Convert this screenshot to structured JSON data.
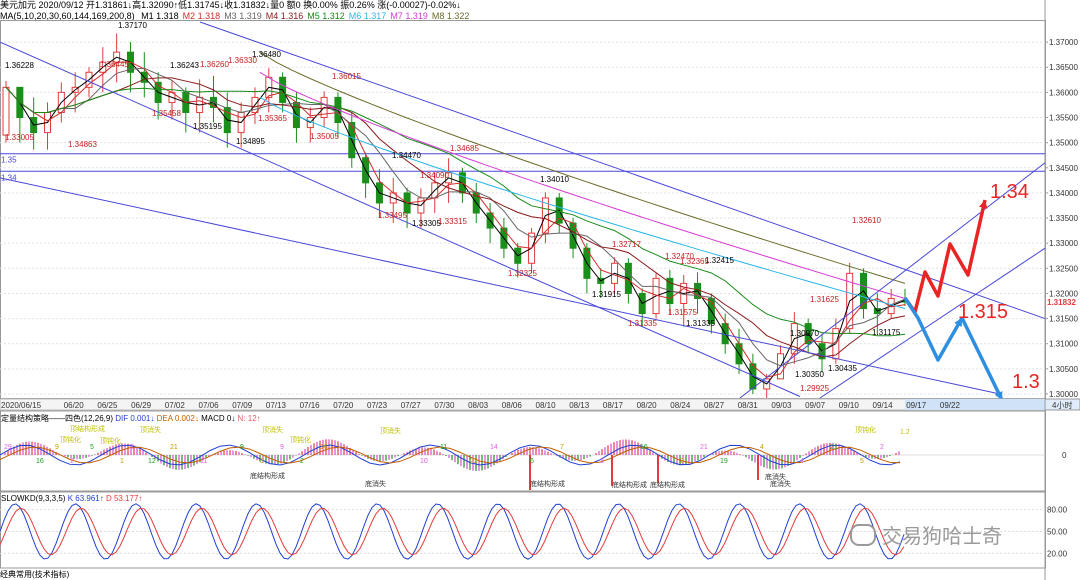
{
  "header": {
    "quote": "美元加元 2020/09/12 开1.31861↓高1.32090↑低1.31745↓收1.31832↓量0 额0 换0.00% 振0.26% 涨(-0.00027)-0.02%↓",
    "ma_label": "MA(5,10,20,30,60,144,169,200,8)",
    "ma_values": [
      {
        "label": "M1 1.318",
        "color": "#000000"
      },
      {
        "label": "M2 1.318",
        "color": "#d22d2d"
      },
      {
        "label": "M3 1.319",
        "color": "#666666"
      },
      {
        "label": "M4 1.316",
        "color": "#8b1a1a"
      },
      {
        "label": "M5 1.312",
        "color": "#1a8a1a"
      },
      {
        "label": "M6 1.317",
        "color": "#2ab6e8"
      },
      {
        "label": "M7 1.319",
        "color": "#d63cd6"
      },
      {
        "label": "M8 1.322",
        "color": "#6b6b2a"
      }
    ]
  },
  "price_axis": {
    "ticks": [
      "1.37000",
      "1.36500",
      "1.36000",
      "1.35500",
      "1.35000",
      "1.34500",
      "1.34000",
      "1.33500",
      "1.33000",
      "1.32500",
      "1.32000",
      "1.31500",
      "1.31000",
      "1.30500",
      "1.30000"
    ],
    "current": "1.31832"
  },
  "date_axis": {
    "labels": [
      "2020/06/15",
      "06/20",
      "06/25",
      "06/29",
      "07/02",
      "07/06",
      "07/09",
      "07/13",
      "07/16",
      "07/20",
      "07/23",
      "07/27",
      "07/30",
      "08/03",
      "08/06",
      "08/10",
      "08/13",
      "08/17",
      "08/20",
      "08/24",
      "08/27",
      "08/31",
      "09/03",
      "09/07",
      "09/10",
      "09/14",
      "09/17",
      "09/22"
    ],
    "period": "4小时"
  },
  "level_lines": {
    "upper": "1.35",
    "lower": "1.34"
  },
  "price_labels": [
    "1.36228",
    "1.37170",
    "1.36445",
    "1.36243",
    "1.36260",
    "1.36330",
    "1.36480",
    "1.36015",
    "1.35458",
    "1.35195",
    "1.35365",
    "1.35005",
    "1.34895",
    "1.34863",
    "1.33005",
    "1.34470",
    "1.34685",
    "1.34090",
    "1.34010",
    "1.33495",
    "1.33315",
    "1.33305",
    "1.32717",
    "1.32470",
    "1.32415",
    "1.32365",
    "1.32325",
    "1.31915",
    "1.31575",
    "1.31335",
    "1.31335",
    "1.32610",
    "1.31625",
    "1.31175",
    "1.30970",
    "1.30435",
    "1.30350",
    "1.29925"
  ],
  "targets": [
    "1.34",
    "1.315",
    "1.3"
  ],
  "indicator1": {
    "title": "定量结构策略——四色(12,26,9)",
    "dif": "DIF 0.001↓",
    "dea": "DEA 0.002↓",
    "macd": "MACD 0↓",
    "n": "N: 12↑",
    "ticks": [
      "0"
    ],
    "annotations": [
      "顶结构形成",
      "顶钝化",
      "顶钝化",
      "顶消失",
      "顶消失",
      "顶钝化",
      "顶消失",
      "顶钝化",
      "1.2",
      "底结构形成",
      "底消失",
      "底结构形成",
      "底结构形成",
      "底结构形成",
      "底消失",
      "底消失"
    ],
    "numbers": [
      "29",
      "16",
      "9",
      "2",
      "5",
      "1",
      "2",
      "12",
      "21",
      "11",
      "9",
      "5",
      "9",
      "2",
      "16",
      "10",
      "11",
      "22",
      "14",
      "6",
      "7",
      "3",
      "16",
      "2",
      "21",
      "19",
      "4",
      "4",
      "21",
      "5",
      "2"
    ]
  },
  "indicator2": {
    "title": "SLOWKD(9,3,3,5)",
    "k": "K 63.961↑",
    "d": "D 53.177↑",
    "ticks": [
      "80.00",
      "50.00",
      "20.00"
    ]
  },
  "watermark": "交易狗哈士奇",
  "statusbar": "经典常用(技术指标)",
  "colors": {
    "up": "#e33b3b",
    "down": "#1a8f1a",
    "channel": "#4848d8",
    "target_up": "#e82424",
    "target_down": "#2e8ee0",
    "price_current": "#e33b3b"
  },
  "chart_data": {
    "type": "candlestick",
    "title": "美元加元 2020/09/12",
    "ylim": [
      1.2992,
      1.374
    ],
    "price_series": [
      [
        "06/15",
        1.3515,
        1.3623,
        1.35,
        1.361
      ],
      [
        "06/16",
        1.361,
        1.36,
        1.35,
        1.355
      ],
      [
        "06/17",
        1.355,
        1.359,
        1.3486,
        1.352
      ],
      [
        "06/18",
        1.352,
        1.358,
        1.3486,
        1.356
      ],
      [
        "06/19",
        1.356,
        1.362,
        1.354,
        1.36
      ],
      [
        "06/22",
        1.36,
        1.364,
        1.356,
        1.361
      ],
      [
        "06/23",
        1.361,
        1.365,
        1.359,
        1.364
      ],
      [
        "06/24",
        1.364,
        1.369,
        1.36,
        1.366
      ],
      [
        "06/25",
        1.366,
        1.3717,
        1.362,
        1.368
      ],
      [
        "06/26",
        1.368,
        1.37,
        1.36,
        1.364
      ],
      [
        "06/29",
        1.364,
        1.368,
        1.359,
        1.362
      ],
      [
        "06/30",
        1.362,
        1.364,
        1.3546,
        1.358
      ],
      [
        "07/01",
        1.358,
        1.3624,
        1.3546,
        1.36
      ],
      [
        "07/02",
        1.36,
        1.361,
        1.352,
        1.356
      ],
      [
        "07/03",
        1.356,
        1.3626,
        1.352,
        1.359
      ],
      [
        "07/06",
        1.359,
        1.3633,
        1.354,
        1.357
      ],
      [
        "07/07",
        1.357,
        1.36,
        1.349,
        1.352
      ],
      [
        "07/08",
        1.352,
        1.358,
        1.349,
        1.356
      ],
      [
        "07/09",
        1.356,
        1.361,
        1.3537,
        1.359
      ],
      [
        "07/10",
        1.359,
        1.3648,
        1.356,
        1.363
      ],
      [
        "07/13",
        1.363,
        1.364,
        1.356,
        1.358
      ],
      [
        "07/14",
        1.358,
        1.36,
        1.35,
        1.353
      ],
      [
        "07/15",
        1.353,
        1.357,
        1.35,
        1.355
      ],
      [
        "07/16",
        1.355,
        1.3602,
        1.353,
        1.359
      ],
      [
        "07/17",
        1.359,
        1.36,
        1.351,
        1.354
      ],
      [
        "07/20",
        1.354,
        1.356,
        1.345,
        1.347
      ],
      [
        "07/21",
        1.347,
        1.348,
        1.339,
        1.342
      ],
      [
        "07/22",
        1.342,
        1.3447,
        1.335,
        1.338
      ],
      [
        "07/23",
        1.338,
        1.343,
        1.334,
        1.34
      ],
      [
        "07/24",
        1.34,
        1.341,
        1.333,
        1.336
      ],
      [
        "07/27",
        1.336,
        1.3409,
        1.333,
        1.339
      ],
      [
        "07/28",
        1.339,
        1.344,
        1.336,
        1.342
      ],
      [
        "07/29",
        1.342,
        1.3469,
        1.338,
        1.344
      ],
      [
        "07/30",
        1.344,
        1.345,
        1.338,
        1.34
      ],
      [
        "07/31",
        1.34,
        1.342,
        1.334,
        1.336
      ],
      [
        "08/03",
        1.336,
        1.338,
        1.33,
        1.333
      ],
      [
        "08/04",
        1.333,
        1.335,
        1.327,
        1.329
      ],
      [
        "08/05",
        1.329,
        1.33,
        1.3232,
        1.326
      ],
      [
        "08/06",
        1.326,
        1.333,
        1.324,
        1.332
      ],
      [
        "08/07",
        1.332,
        1.3401,
        1.33,
        1.339
      ],
      [
        "08/10",
        1.339,
        1.34,
        1.332,
        1.334
      ],
      [
        "08/11",
        1.334,
        1.335,
        1.327,
        1.329
      ],
      [
        "08/12",
        1.329,
        1.33,
        1.32,
        1.323
      ],
      [
        "08/13",
        1.323,
        1.325,
        1.3191,
        1.322
      ],
      [
        "08/14",
        1.322,
        1.3272,
        1.32,
        1.326
      ],
      [
        "08/17",
        1.326,
        1.327,
        1.318,
        1.32
      ],
      [
        "08/18",
        1.32,
        1.321,
        1.3134,
        1.316
      ],
      [
        "08/19",
        1.316,
        1.324,
        1.315,
        1.323
      ],
      [
        "08/20",
        1.323,
        1.3247,
        1.3158,
        1.318
      ],
      [
        "08/21",
        1.318,
        1.3237,
        1.3134,
        1.322
      ],
      [
        "08/24",
        1.322,
        1.3242,
        1.316,
        1.319
      ],
      [
        "08/25",
        1.319,
        1.32,
        1.312,
        1.314
      ],
      [
        "08/26",
        1.314,
        1.316,
        1.308,
        1.31
      ],
      [
        "08/27",
        1.31,
        1.313,
        1.304,
        1.306
      ],
      [
        "08/28",
        1.306,
        1.308,
        1.3,
        1.301
      ],
      [
        "08/31",
        1.301,
        1.304,
        1.2992,
        1.303
      ],
      [
        "09/01",
        1.303,
        1.3097,
        1.3035,
        1.308
      ],
      [
        "09/02",
        1.308,
        1.3163,
        1.306,
        1.314
      ],
      [
        "09/03",
        1.314,
        1.315,
        1.308,
        1.31
      ],
      [
        "09/04",
        1.31,
        1.312,
        1.3043,
        1.307
      ],
      [
        "09/07",
        1.307,
        1.315,
        1.306,
        1.313
      ],
      [
        "09/08",
        1.313,
        1.3261,
        1.312,
        1.324
      ],
      [
        "09/09",
        1.324,
        1.325,
        1.315,
        1.317
      ],
      [
        "09/10",
        1.317,
        1.32,
        1.3117,
        1.316
      ],
      [
        "09/11",
        1.316,
        1.3209,
        1.315,
        1.319
      ],
      [
        "09/12",
        1.3186,
        1.3209,
        1.3175,
        1.3183
      ]
    ]
  }
}
